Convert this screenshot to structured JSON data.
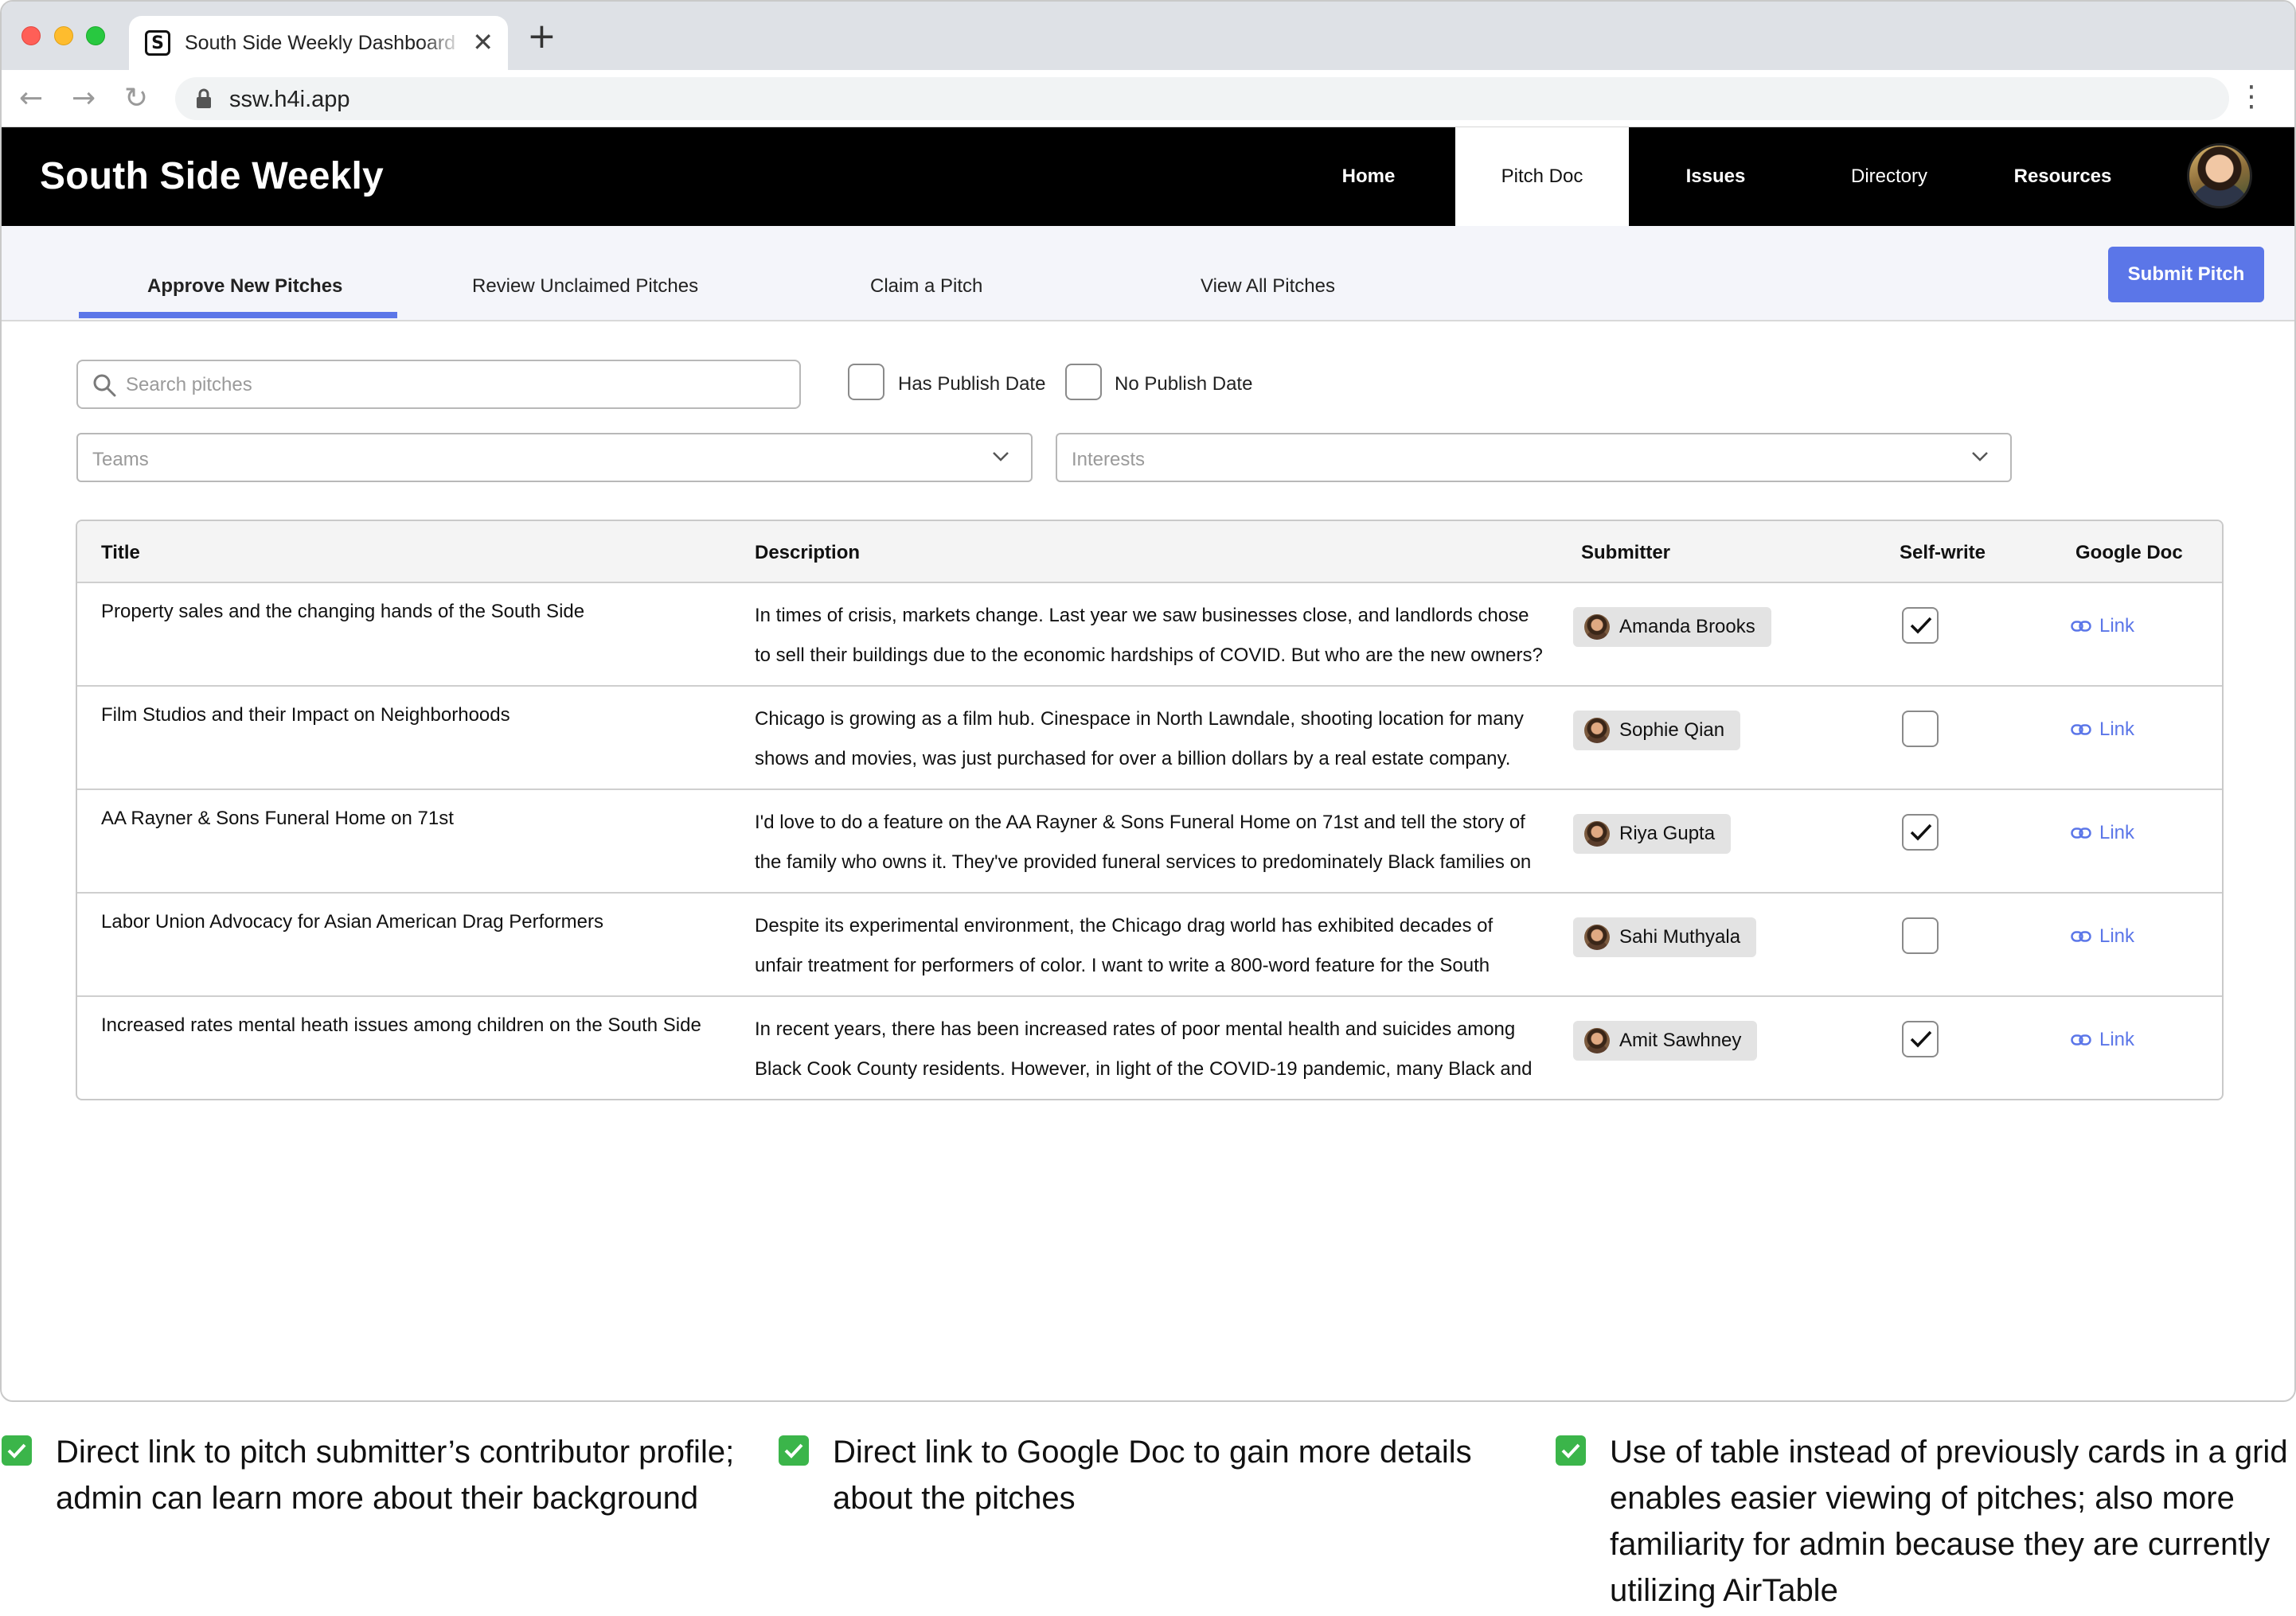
{
  "browser": {
    "tab_title": "South Side Weekly Dashboard",
    "favicon_letter": "S",
    "url": "ssw.h4i.app"
  },
  "app": {
    "brand": "South Side Weekly",
    "nav": [
      {
        "label": "Home",
        "active": false
      },
      {
        "label": "Pitch Doc",
        "active": true
      },
      {
        "label": "Issues",
        "active": false
      },
      {
        "label": "Directory",
        "active": false
      },
      {
        "label": "Resources",
        "active": false
      }
    ]
  },
  "subnav": {
    "tabs": [
      {
        "label": "Approve New Pitches",
        "active": true
      },
      {
        "label": "Review Unclaimed Pitches",
        "active": false
      },
      {
        "label": "Claim a Pitch",
        "active": false
      },
      {
        "label": "View All Pitches",
        "active": false
      }
    ],
    "submit_label": "Submit Pitch"
  },
  "filters": {
    "search_placeholder": "Search pitches",
    "has_publish_date": "Has Publish Date",
    "no_publish_date": "No Publish Date",
    "teams_placeholder": "Teams",
    "interests_placeholder": "Interests"
  },
  "table": {
    "headers": {
      "title": "Title",
      "description": "Description",
      "submitter": "Submitter",
      "self_write": "Self-write",
      "google_doc": "Google Doc"
    },
    "rows": [
      {
        "title": "Property sales and the changing hands of the South Side",
        "description": "In times of crisis, markets change. Last year we saw businesses close, and landlords chose to sell their buildings due to the economic hardships of COVID. But who are the new owners?",
        "submitter": "Amanda Brooks",
        "self_write": true,
        "link": "Link"
      },
      {
        "title": "Film Studios and their Impact on Neighborhoods",
        "description": "Chicago is growing as a film hub. Cinespace in North Lawndale, shooting location for many shows and movies, was just purchased for over a billion dollars by a real estate company.",
        "submitter": "Sophie Qian",
        "self_write": false,
        "link": "Link"
      },
      {
        "title": "AA Rayner & Sons Funeral Home on 71st",
        "description": "I'd love to do a feature on the AA Rayner & Sons Funeral Home on 71st and tell the story of the family who owns it. They've provided funeral services to predominately Black families on",
        "submitter": "Riya Gupta",
        "self_write": true,
        "link": "Link"
      },
      {
        "title": "Labor Union Advocacy for Asian American Drag Performers",
        "description": "Despite its experimental environment, the Chicago drag world has exhibited decades of unfair treatment for performers of color. I want to write a 800-word feature for the South",
        "submitter": "Sahi Muthyala",
        "self_write": false,
        "link": "Link"
      },
      {
        "title": "Increased rates mental heath issues among children on the South Side",
        "description": "In recent years, there has been increased rates of poor mental health and suicides among Black Cook County residents. However, in light of the COVID-19 pandemic, many Black and",
        "submitter": "Amit Sawhney",
        "self_write": true,
        "link": "Link"
      }
    ]
  },
  "annotations": [
    "Direct link to pitch submitter’s contributor profile; admin can learn more about their background",
    "Direct link to Google Doc to gain more details about the pitches",
    "Use of table instead of previously cards in a grid enables easier viewing of pitches; also more familiarity for admin because they are currently utilizing AirTable"
  ],
  "colors": {
    "accent": "#5b76e8",
    "header_bg": "#000000",
    "subnav_bg": "#f4f5fa",
    "check_green": "#3bb54a"
  }
}
